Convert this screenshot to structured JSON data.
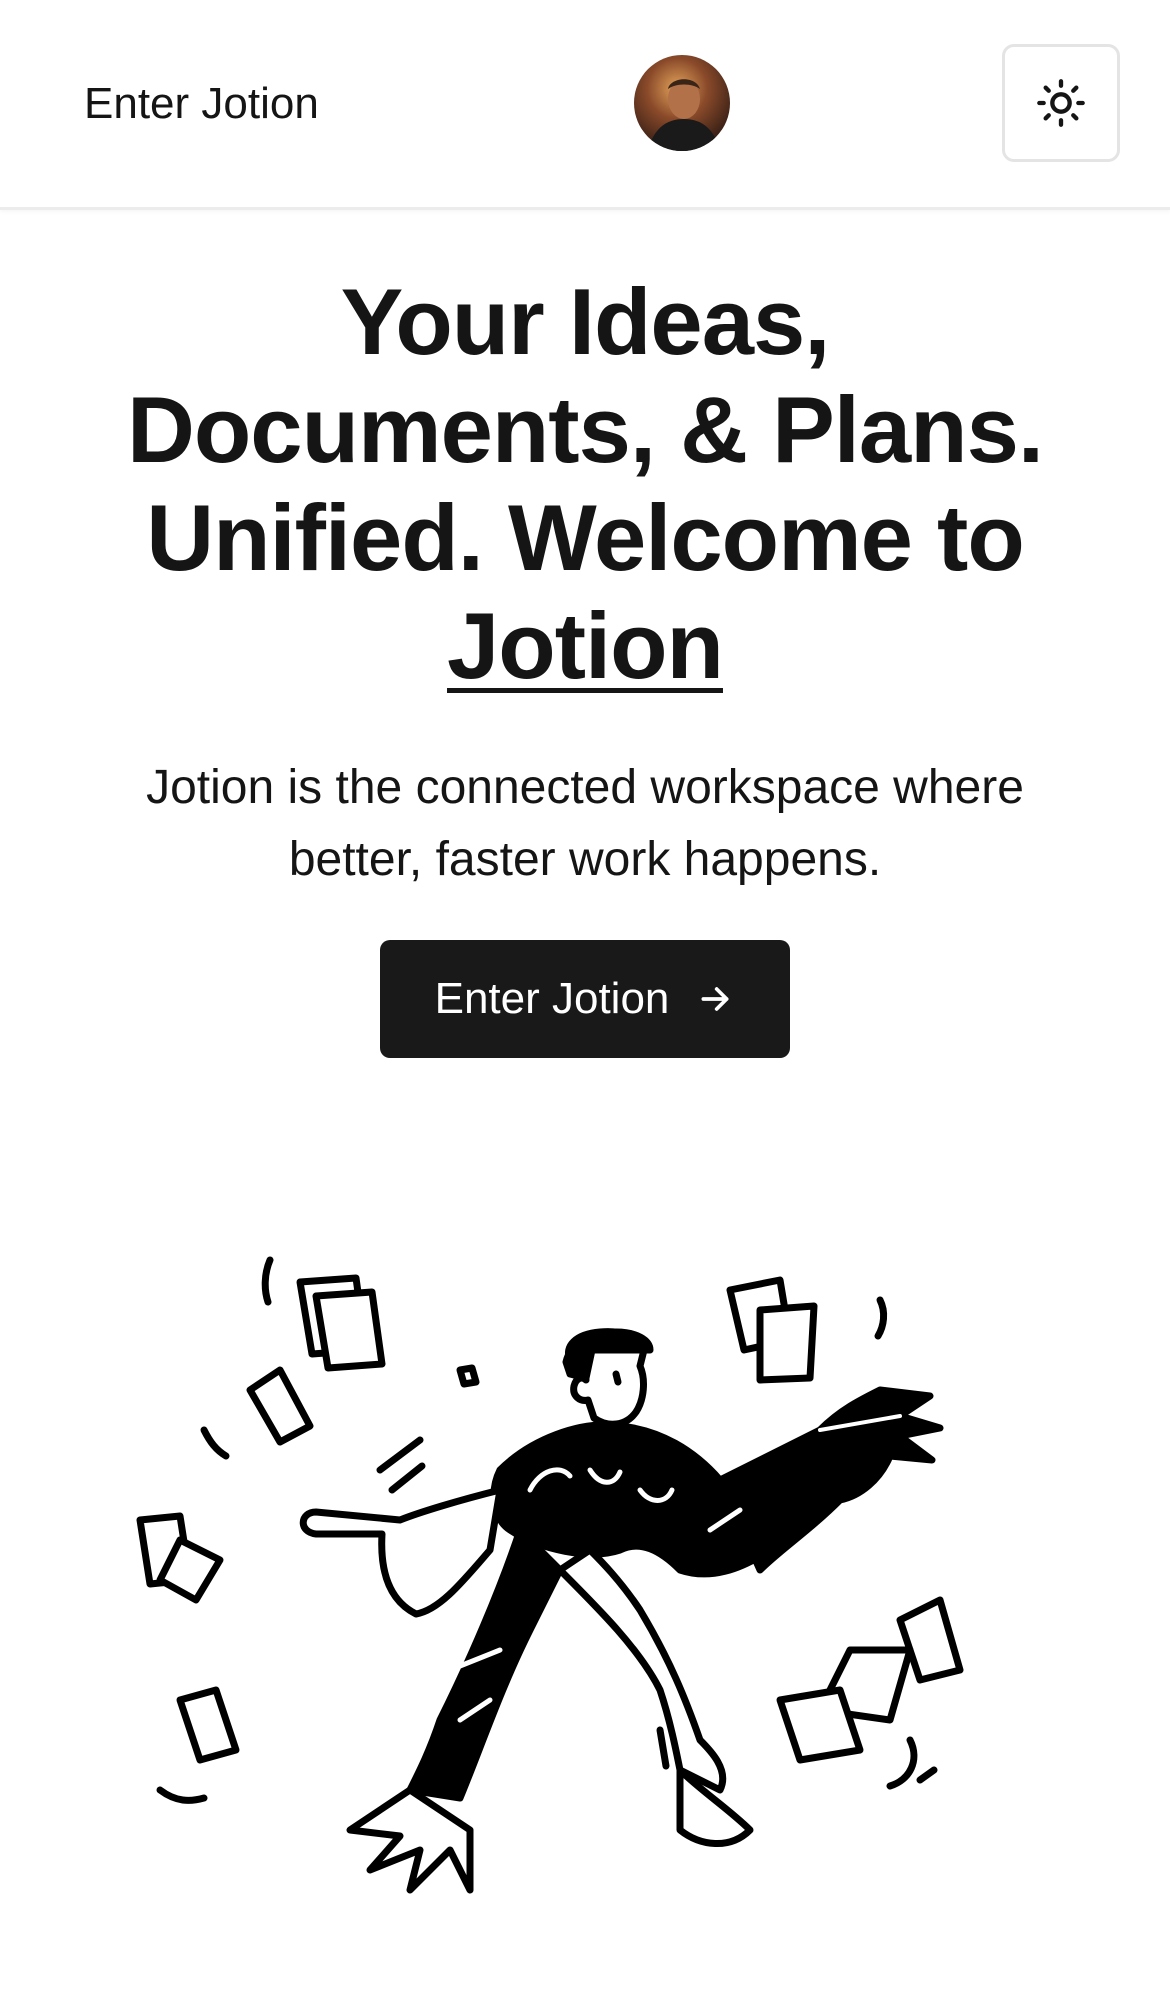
{
  "navbar": {
    "link_label": "Enter Jotion",
    "avatar_alt": "User avatar",
    "theme_toggle_icon": "sun-icon"
  },
  "hero": {
    "title_line1": "Your Ideas,",
    "title_line2": "Documents, & Plans.",
    "title_line3": "Unified. Welcome to",
    "title_brand": "Jotion",
    "subtitle_line1": "Jotion is the connected workspace where",
    "subtitle_line2": "better, faster work happens.",
    "cta_label": "Enter Jotion",
    "cta_icon": "arrow-right-icon"
  },
  "illustration": {
    "icon": "person-juggling-papers-illustration"
  },
  "colors": {
    "text": "#151515",
    "button_bg": "#191919",
    "border": "#e4e4e4"
  }
}
